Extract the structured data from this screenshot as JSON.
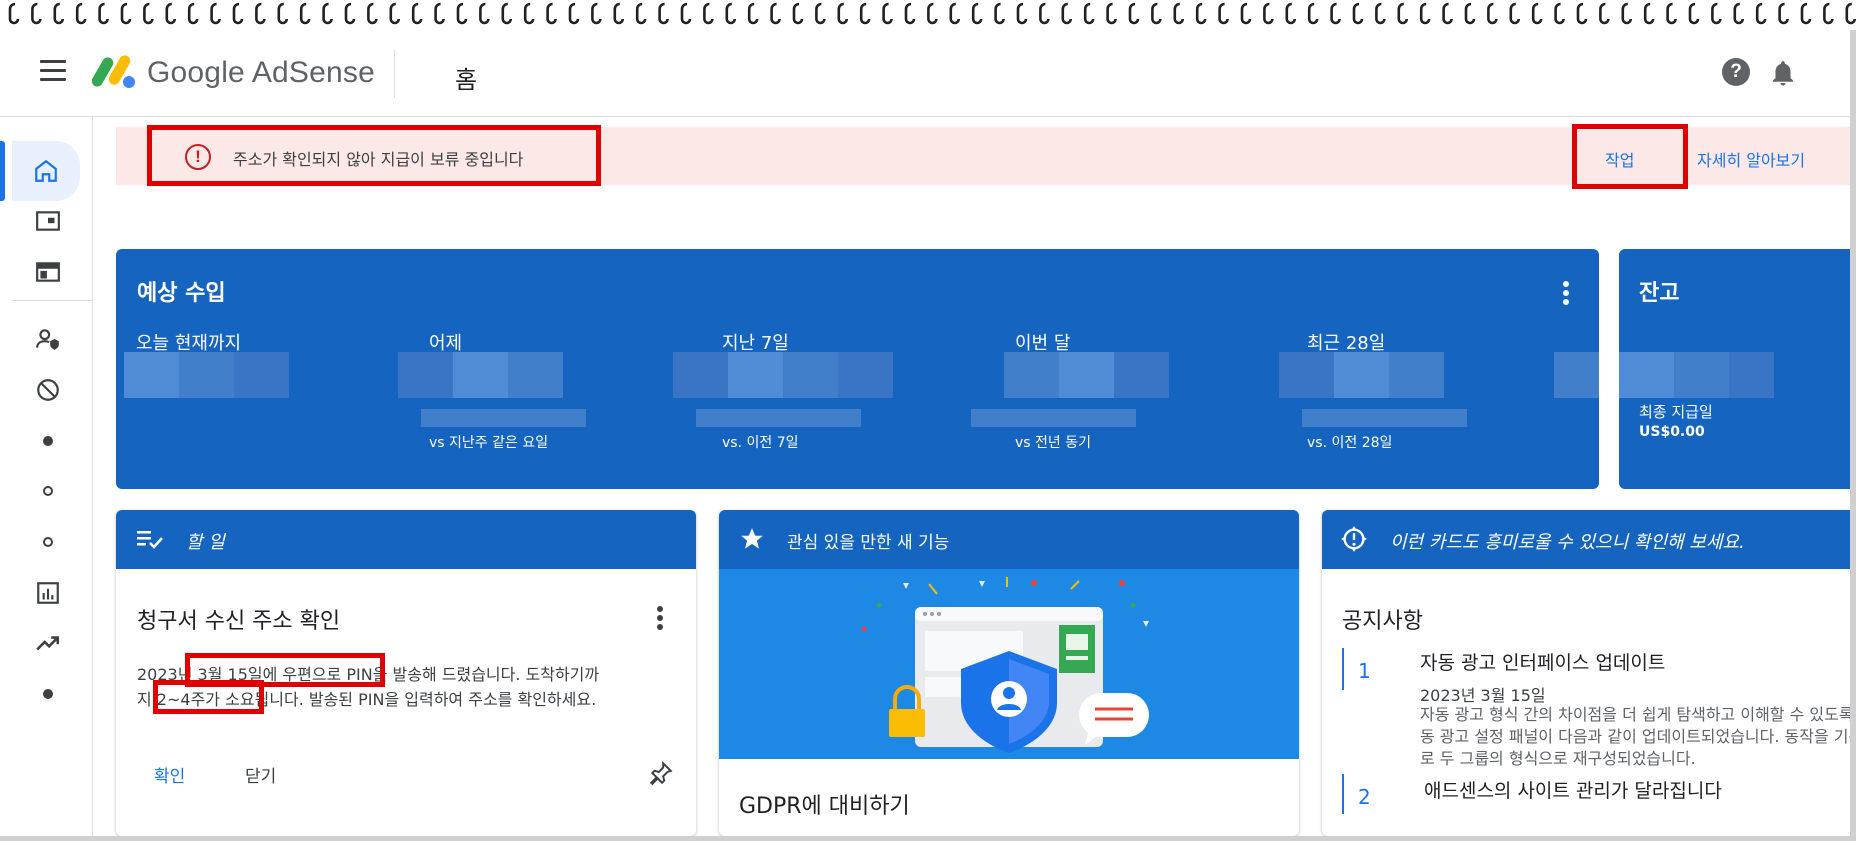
{
  "app": {
    "brand": "Google AdSense",
    "page_title": "홈"
  },
  "alert": {
    "message": "주소가 확인되지 않아 지급이 보류 중입니다",
    "action_label": "작업",
    "learn_more_label": "자세히 알아보기"
  },
  "earnings": {
    "title": "예상 수입",
    "metrics": [
      {
        "label": "오늘 현재까지",
        "comparison": ""
      },
      {
        "label": "어제",
        "comparison": "vs 지난주 같은 요일"
      },
      {
        "label": "지난 7일",
        "comparison": "vs. 이전 7일"
      },
      {
        "label": "이번 달",
        "comparison": "vs 전년 동기"
      },
      {
        "label": "최근 28일",
        "comparison": "vs. 이전 28일"
      }
    ]
  },
  "balance": {
    "title": "잔고",
    "last_payment_label": "최종 지급일",
    "last_payment_value": "US$0.00"
  },
  "todo": {
    "header": "할 일",
    "title": "청구서 수신 주소 확인",
    "body_line1": "2023년 3월 15일에 우편으로 PIN을 발송해 드렸습니다. 도착하기까",
    "body_line2": "지 2~4주가 소요됩니다. 발송된 PIN을 입력하여 주소를 확인하세요.",
    "confirm_label": "확인",
    "close_label": "닫기"
  },
  "features": {
    "header": "관심 있을 만한 새 기능",
    "item_title": "GDPR에 대비하기"
  },
  "notices": {
    "header": "이런 카드도 흥미로울 수 있으니 확인해 보세요.",
    "title": "공지사항",
    "items": [
      {
        "number": "1",
        "title": "자동 광고 인터페이스 업데이트",
        "date": "2023년 3월 15일",
        "body": "자동 광고 형식 간의 차이점을 더 쉽게 탐색하고 이해할 수 있도록 자동 광고 설정 패널이 다음과 같이 업데이트되었습니다. 동작을 기준으로 두 그룹의 형식으로 재구성되었습니다."
      },
      {
        "number": "2",
        "title": "애드센스의 사이트 관리가 달라집니다"
      }
    ]
  },
  "colors": {
    "primary": "#1565c0",
    "link": "#1a73e8",
    "alert_bg": "#fce8e6",
    "highlight_box": "#e00000"
  },
  "icons": [
    "menu-icon",
    "adsense-logo-icon",
    "help-icon",
    "bell-icon",
    "home-icon",
    "sites-icon",
    "ads-icon",
    "privacy-icon",
    "block-icon",
    "reports-icon",
    "trending-icon",
    "task-list-icon",
    "star-icon",
    "lightbulb-icon",
    "alert-icon",
    "pin-icon"
  ]
}
